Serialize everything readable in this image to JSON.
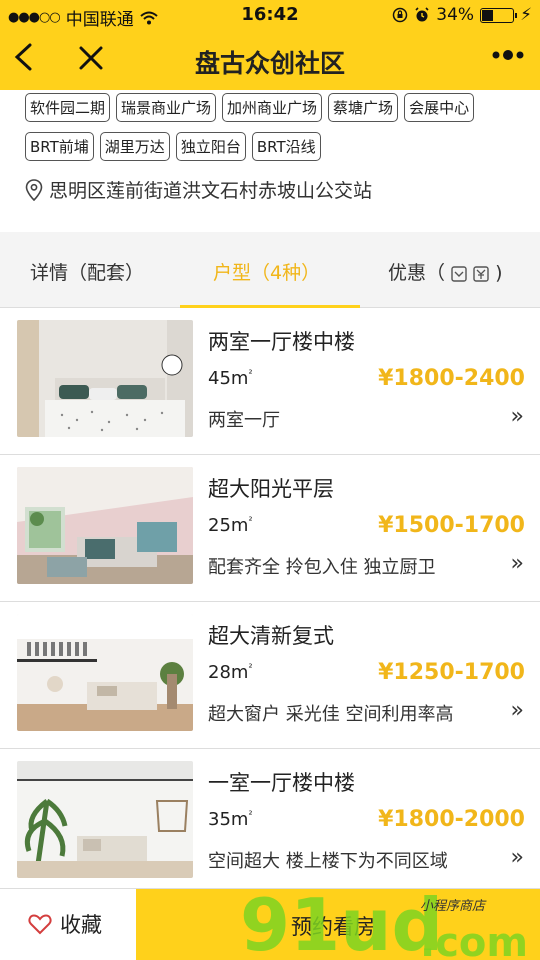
{
  "status_bar": {
    "signal_dots": "●●●○○",
    "carrier": "中国联通",
    "time": "16:42",
    "battery_percent": "34%",
    "battery_level": 0.34
  },
  "nav": {
    "title": "盘古众创社区"
  },
  "tags_row1": [
    "软件园二期",
    "瑞景商业广场",
    "加州商业广场",
    "蔡塘广场",
    "会展中心"
  ],
  "tags_row2": [
    "BRT前埔",
    "湖里万达",
    "独立阳台",
    "BRT沿线"
  ],
  "address": "思明区莲前街道洪文石村赤坡山公交站",
  "tabs": {
    "details": "详情（配套）",
    "units": "户型（4种）",
    "offers": "优惠（"
  },
  "rooms": [
    {
      "name": "两室一厅楼中楼",
      "area": "45m",
      "area_sup": "²",
      "price": "¥1800-2400",
      "desc": "两室一厅"
    },
    {
      "name": "超大阳光平层",
      "area": "25m",
      "area_sup": "²",
      "price": "¥1500-1700",
      "desc": "配套齐全 拎包入住 独立厨卫"
    },
    {
      "name": "超大清新复式",
      "area": "28m",
      "area_sup": "²",
      "price": "¥1250-1700",
      "desc": "超大窗户 采光佳 空间利用率高"
    },
    {
      "name": "一室一厅楼中楼",
      "area": "35m",
      "area_sup": "²",
      "price": "¥1800-2000",
      "desc": "空间超大 楼上楼下为不同区域"
    }
  ],
  "bottom": {
    "favorite": "收藏",
    "book": "预约看房"
  },
  "watermark": {
    "text": "91ud",
    "dotcom": ".com",
    "sub": "小程序商店"
  },
  "colors": {
    "brand_yellow": "#ffd11b",
    "price": "#f1b61a",
    "watermark_green": "#7ed321"
  }
}
